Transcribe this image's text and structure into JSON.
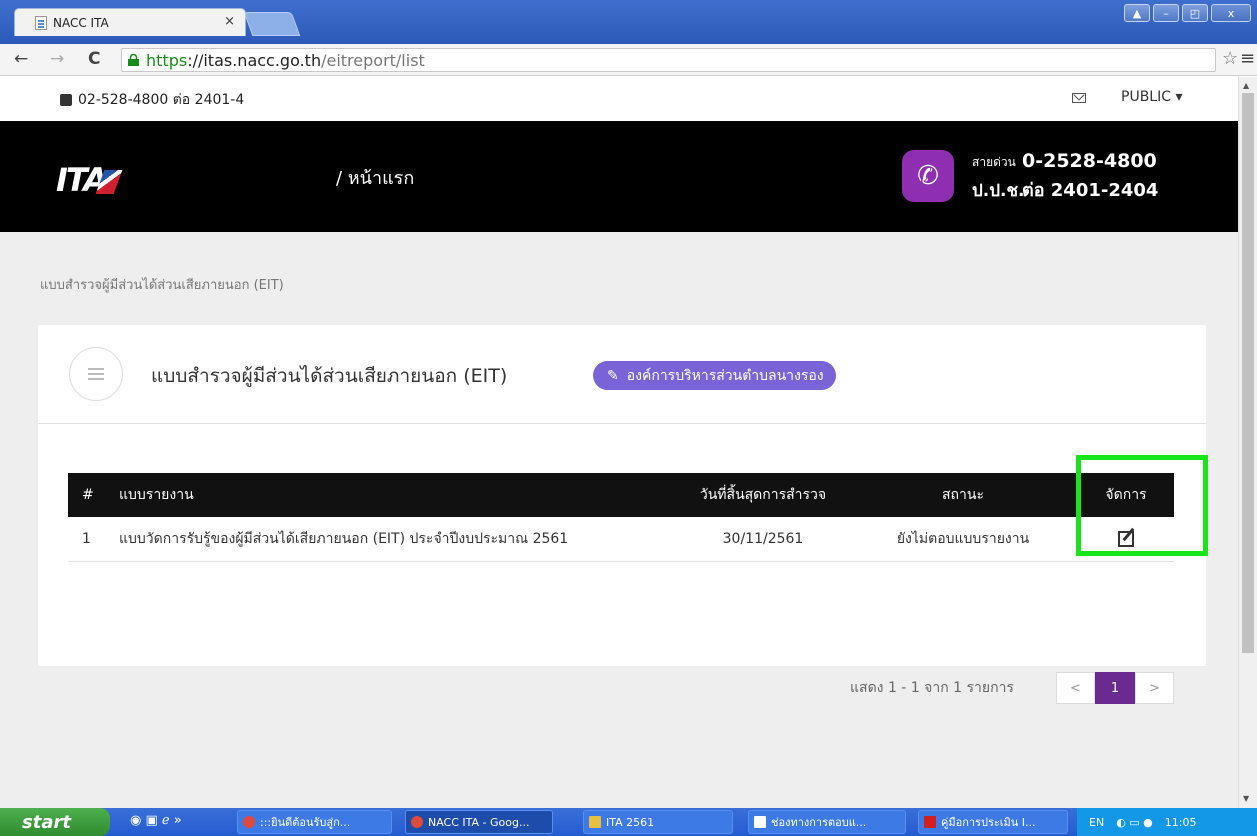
{
  "browser": {
    "tab_title": "NACC ITA",
    "tab_close": "×",
    "url_https": "https",
    "url_host": "://itas.nacc.go.th",
    "url_path": "/eitreport/list",
    "win_min": "–",
    "win_max": "◰",
    "win_close": "x",
    "win_user": "▲"
  },
  "topbar": {
    "phone": "02-528-4800 ต่อ 2401-4",
    "public_label": "PUBLIC ▾"
  },
  "header": {
    "logo_text": "ITA",
    "breadcrumb": "/ หน้าแรก",
    "hotline_label1": "สายด่วน",
    "hotline_label2": "ป.ป.ช.",
    "hotline_number": "0-2528-4800",
    "hotline_ext": "ต่อ 2401-2404"
  },
  "page": {
    "breadcrumb": "แบบสำรวจผู้มีส่วนได้ส่วนเสียภายนอก (EIT)",
    "title": "แบบสำรวจผู้มีส่วนได้ส่วนเสียภายนอก (EIT)",
    "org_badge": "องค์การบริหารส่วนตำบลนางรอง"
  },
  "table": {
    "headers": [
      "#",
      "แบบรายงาน",
      "วันที่สิ้นสุดการสำรวจ",
      "สถานะ",
      "จัดการ"
    ],
    "rows": [
      {
        "num": "1",
        "report": "แบบวัดการรับรู้ของผู้มีส่วนได้เสียภายนอก (EIT) ประจำปีงบประมาณ 2561",
        "end_date": "30/11/2561",
        "status": "ยังไม่ตอบแบบรายงาน"
      }
    ]
  },
  "pagination": {
    "info": "แสดง 1 - 1 จาก 1 รายการ",
    "prev": "<",
    "current": "1",
    "next": ">"
  },
  "taskbar": {
    "start": "start",
    "items": [
      ":::ยินดีต้อนรับสู่ก...",
      "NACC ITA - Goog...",
      "ITA 2561",
      "ช่องทางการตอบแ...",
      "คู่มือการประเมิน I..."
    ],
    "lang": "EN",
    "time": "11:05"
  },
  "colors": {
    "accent_purple": "#7a63d6",
    "hotline_purple": "#8d2fb0",
    "highlight_green": "#19e619",
    "page_active": "#6a2a8f"
  }
}
